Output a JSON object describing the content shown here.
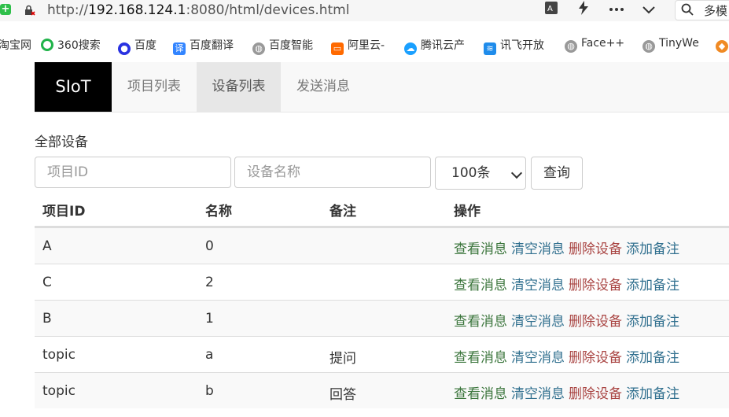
{
  "browser": {
    "url_prefix": "http://",
    "url_host": "192.168.124.1",
    "url_rest": ":8080/html/devices.html",
    "search_text": "多模"
  },
  "bookmarks": [
    {
      "label": "淘宝网",
      "icon": "taobao-icon"
    },
    {
      "label": "360搜索",
      "icon": "360-icon",
      "color": "#20b34a"
    },
    {
      "label": "百度",
      "icon": "baidu-paw-icon",
      "color": "#2932e1"
    },
    {
      "label": "百度翻译",
      "icon": "translate-icon",
      "color": "#3385ff"
    },
    {
      "label": "百度智能",
      "icon": "globe-icon",
      "color": "#888888"
    },
    {
      "label": "阿里云-",
      "icon": "aliyun-icon",
      "color": "#ff6a00"
    },
    {
      "label": "腾讯云产",
      "icon": "cloud-icon",
      "color": "#1aa0ff"
    },
    {
      "label": "讯飞开放",
      "icon": "xunfei-icon",
      "color": "#1f8ceb"
    },
    {
      "label": "Face++",
      "icon": "globe-icon",
      "color": "#888888"
    },
    {
      "label": "TinyWe",
      "icon": "globe-icon",
      "color": "#888888"
    }
  ],
  "nav": {
    "brand": "SIoT",
    "links": [
      "项目列表",
      "设备列表",
      "发送消息"
    ],
    "active": "设备列表"
  },
  "page": {
    "title": "全部设备",
    "project_id_placeholder": "项目ID",
    "device_name_placeholder": "设备名称",
    "limit_selected": "100条",
    "query_button": "查询"
  },
  "table": {
    "headers": [
      "项目ID",
      "名称",
      "备注",
      "操作"
    ],
    "rows": [
      {
        "project": "A",
        "name": "0",
        "note": ""
      },
      {
        "project": "C",
        "name": "2",
        "note": ""
      },
      {
        "project": "B",
        "name": "1",
        "note": ""
      },
      {
        "project": "topic",
        "name": "a",
        "note": "提问"
      },
      {
        "project": "topic",
        "name": "b",
        "note": "回答"
      }
    ],
    "actions": [
      {
        "label": "查看消息",
        "color": "#3c763d"
      },
      {
        "label": "清空消息",
        "color": "#31708f"
      },
      {
        "label": "删除设备",
        "color": "#a94442"
      },
      {
        "label": "添加备注",
        "color": "#31708f"
      }
    ]
  }
}
